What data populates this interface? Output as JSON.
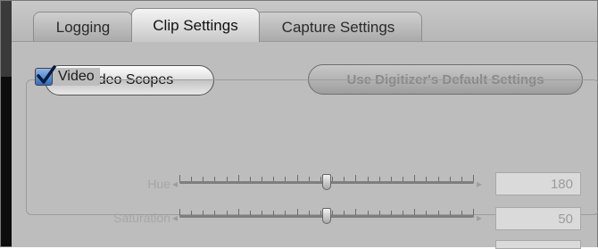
{
  "tabs": [
    {
      "label": "Logging",
      "active": false
    },
    {
      "label": "Clip Settings",
      "active": true
    },
    {
      "label": "Capture Settings",
      "active": false
    }
  ],
  "buttons": {
    "video_scopes": "Video Scopes",
    "digitizer_defaults": "Use Digitizer's Default Settings"
  },
  "video_group": {
    "label": "Video",
    "checked": true,
    "sliders": [
      {
        "name": "Hue",
        "value": "180",
        "level": 0.5
      },
      {
        "name": "Saturation",
        "value": "50",
        "level": 0.5
      }
    ]
  }
}
